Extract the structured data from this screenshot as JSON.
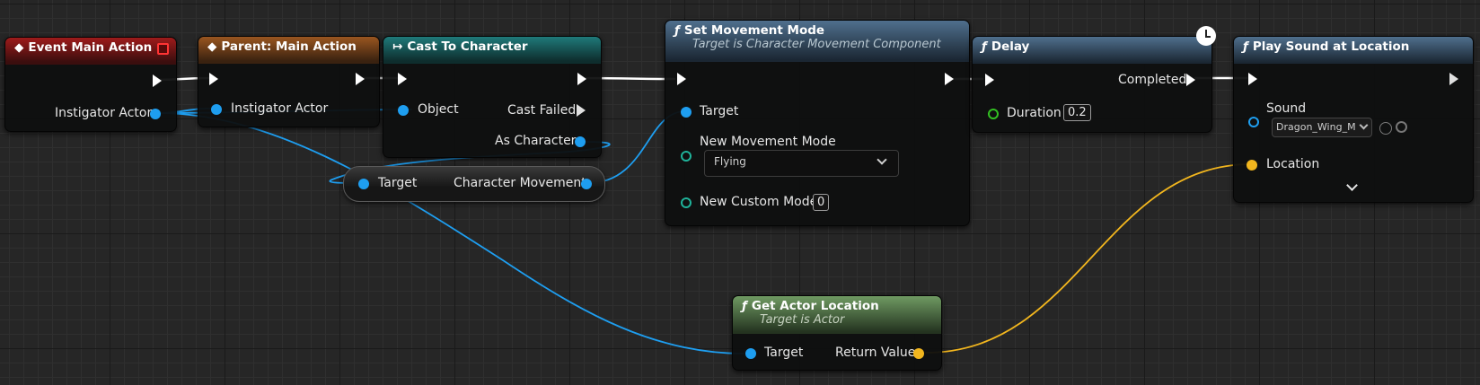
{
  "nodes": {
    "event_main_action": {
      "title": "Event Main Action",
      "pins": {
        "instigator": "Instigator Actor"
      }
    },
    "parent_main_action": {
      "title": "Parent: Main Action",
      "pins": {
        "instigator": "Instigator Actor"
      }
    },
    "cast_to_character": {
      "title": "Cast To Character",
      "pins": {
        "object": "Object",
        "cast_failed": "Cast Failed",
        "as_character": "As Character"
      }
    },
    "character_movement": {
      "pins": {
        "target": "Target",
        "movement": "Character Movement"
      }
    },
    "set_movement_mode": {
      "title": "Set Movement Mode",
      "subtitle": "Target is Character Movement Component",
      "pins": {
        "target": "Target",
        "new_mode": "New Movement Mode",
        "new_custom": "New Custom Mode"
      },
      "mode_value": "Flying",
      "custom_value": "0"
    },
    "delay": {
      "title": "Delay",
      "pins": {
        "completed": "Completed",
        "duration": "Duration"
      },
      "duration_value": "0.2"
    },
    "play_sound": {
      "title": "Play Sound at Location",
      "pins": {
        "sound": "Sound",
        "location": "Location"
      },
      "sound_value": "Dragon_Wing_M"
    },
    "get_actor_location": {
      "title": "Get Actor Location",
      "subtitle": "Target is Actor",
      "pins": {
        "target": "Target",
        "return_value": "Return Value"
      }
    }
  },
  "glyphs": {
    "function": "ƒ",
    "event": "◆",
    "cast": "↦"
  },
  "colors": {
    "exec": "#ffffff",
    "object": "#1e9ef0",
    "enum": "#1fb39a",
    "float": "#33c022",
    "vector": "#f2b61e"
  }
}
